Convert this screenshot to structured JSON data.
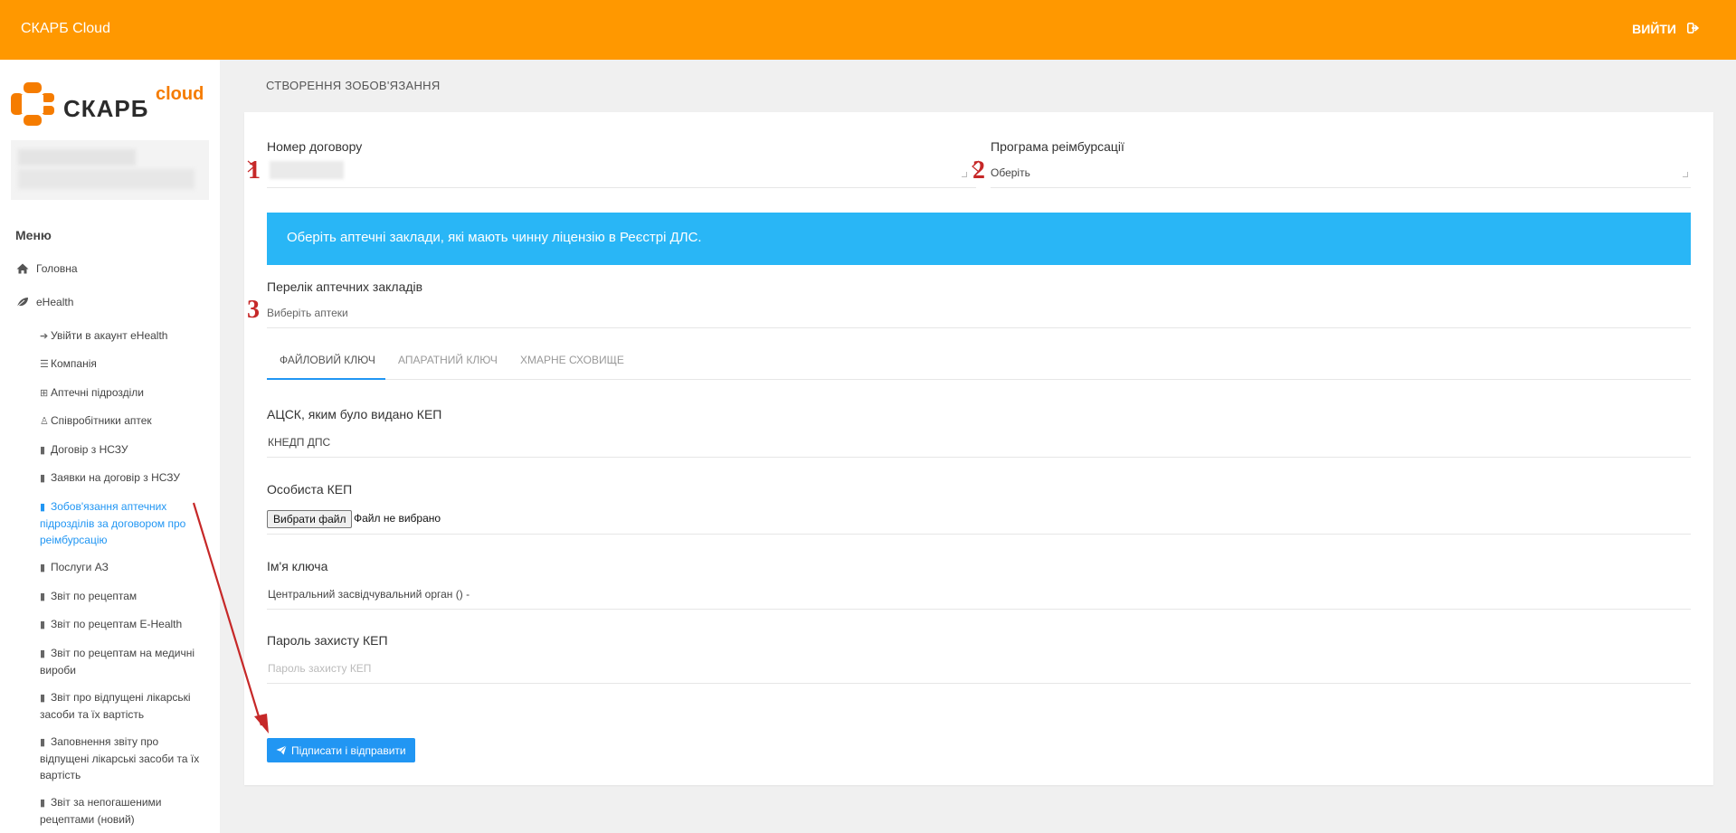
{
  "topbar": {
    "app_title": "СКАРБ Cloud",
    "logout_label": "ВИЙТИ"
  },
  "logo": {
    "word": "СКАРБ",
    "cloud": "cloud"
  },
  "sidebar": {
    "menu_title": "Меню",
    "items": [
      {
        "label": "Головна",
        "icon": "home-icon"
      },
      {
        "label": "eHealth",
        "icon": "leaf-icon"
      }
    ],
    "subitems": [
      {
        "label": "Увійти в акаунт eHealth",
        "icon": "sign-in-icon"
      },
      {
        "label": "Компанія",
        "icon": "database-icon"
      },
      {
        "label": "Аптечні підрозділи",
        "icon": "plus-square-icon"
      },
      {
        "label": "Співробітники аптек",
        "icon": "user-icon"
      },
      {
        "label": "Договір з НСЗУ",
        "icon": "file-icon"
      },
      {
        "label": "Заявки на договір з НСЗУ",
        "icon": "file-icon"
      },
      {
        "label": "Зобов'язання аптечних підрозділів за договором про реімбурсацію",
        "icon": "file-icon",
        "active": true
      },
      {
        "label": "Послуги АЗ",
        "icon": "file-icon"
      },
      {
        "label": "Звіт по рецептам",
        "icon": "file-icon"
      },
      {
        "label": "Звіт по рецептам E-Health",
        "icon": "file-icon"
      },
      {
        "label": "Звіт по рецептам на медичні вироби",
        "icon": "file-icon"
      },
      {
        "label": "Звіт про відпущені лікарські засоби та їх вартість",
        "icon": "file-icon"
      },
      {
        "label": "Заповнення звіту про відпущені лікарські засоби та їх вартість",
        "icon": "file-icon"
      },
      {
        "label": "Звіт за непогашеними рецептами (новий)",
        "icon": "file-icon"
      }
    ]
  },
  "page": {
    "header": "СТВОРЕННЯ ЗОБОВ'ЯЗАННЯ"
  },
  "form": {
    "contract_label": "Номер договору",
    "program_label": "Програма реімбурсації",
    "program_value": "Оберіть",
    "alert_text": "Оберіть аптечні заклади, які мають чинну ліцензію в Реєстрі ДЛС.",
    "pharmacies_label": "Перелік аптечних закладів",
    "pharmacies_placeholder": "Виберіть аптеки",
    "tabs": [
      "ФАЙЛОВИЙ КЛЮЧ",
      "АПАРАТНИЙ КЛЮЧ",
      "ХМАРНЕ СХОВИЩЕ"
    ],
    "acsk_label": "АЦСК, яким було видано КЕП",
    "acsk_value": "КНЕДП ДПС",
    "key_label": "Особиста КЕП",
    "file_button": "Вибрати файл",
    "file_status": "Файл не вибрано",
    "key_name_label": "Ім'я ключа",
    "key_name_value": "Центральний засвідчувальний орган () -",
    "password_label": "Пароль захисту КЕП",
    "password_placeholder": "Пароль захисту КЕП",
    "submit_label": "Підписати і відправити"
  },
  "annotations": [
    "1",
    "2",
    "3"
  ],
  "colors": {
    "topbar": "#ff9800",
    "alert": "#29b6f6",
    "primary": "#2196f3",
    "annotation": "#c62828"
  }
}
